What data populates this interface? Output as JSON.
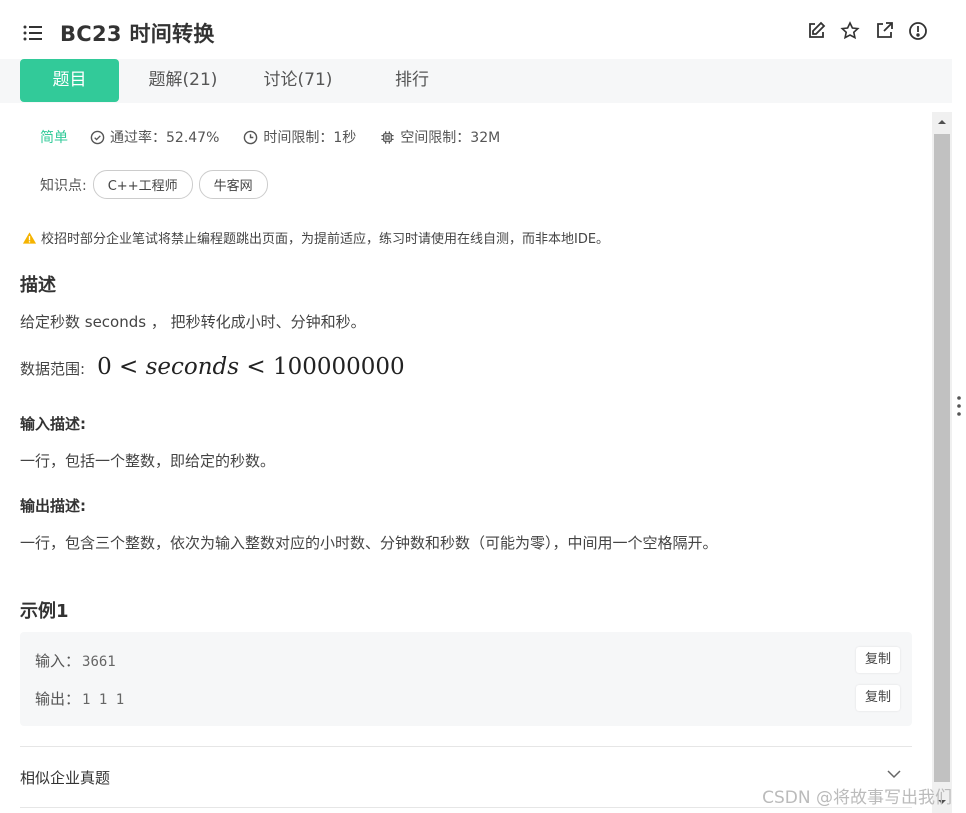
{
  "header": {
    "title": "BC23  时间转换",
    "icons": [
      "list-icon",
      "edit-icon",
      "star-icon",
      "share-icon",
      "report-icon"
    ]
  },
  "tabs": [
    {
      "label": "题目",
      "active": true
    },
    {
      "label": "题解(21)",
      "active": false
    },
    {
      "label": "讨论(71)",
      "active": false
    },
    {
      "label": "排行",
      "active": false
    }
  ],
  "meta": {
    "difficulty": "简单",
    "pass_rate": "通过率：52.47%",
    "time_limit": "时间限制：1秒",
    "space_limit": "空间限制：32M"
  },
  "knowledge": {
    "label": "知识点:",
    "tags": [
      "C++工程师",
      "牛客网"
    ]
  },
  "warning": "校招时部分企业笔试将禁止编程题跳出页面，为提前适应，练习时请使用在线自测，而非本地IDE。",
  "description": {
    "heading": "描述",
    "text": "给定秒数 seconds ， 把秒转化成小时、分钟和秒。",
    "range_label": "数据范围:",
    "range_left": "0 <",
    "range_var": "seconds",
    "range_right": "< 100000000"
  },
  "input_desc": {
    "heading": "输入描述:",
    "text": "一行，包括一个整数，即给定的秒数。"
  },
  "output_desc": {
    "heading": "输出描述:",
    "text": "一行，包含三个整数，依次为输入整数对应的小时数、分钟数和秒数（可能为零），中间用一个空格隔开。"
  },
  "example": {
    "heading": "示例1",
    "input_label": "输入：",
    "input_value": "3661",
    "output_label": "输出：",
    "output_value": "1 1 1",
    "copy_label": "复制"
  },
  "similar": {
    "label": "相似企业真题"
  },
  "watermark": "CSDN @将故事写出我们",
  "colors": {
    "accent": "#32ca99",
    "warning": "#f5b300"
  }
}
